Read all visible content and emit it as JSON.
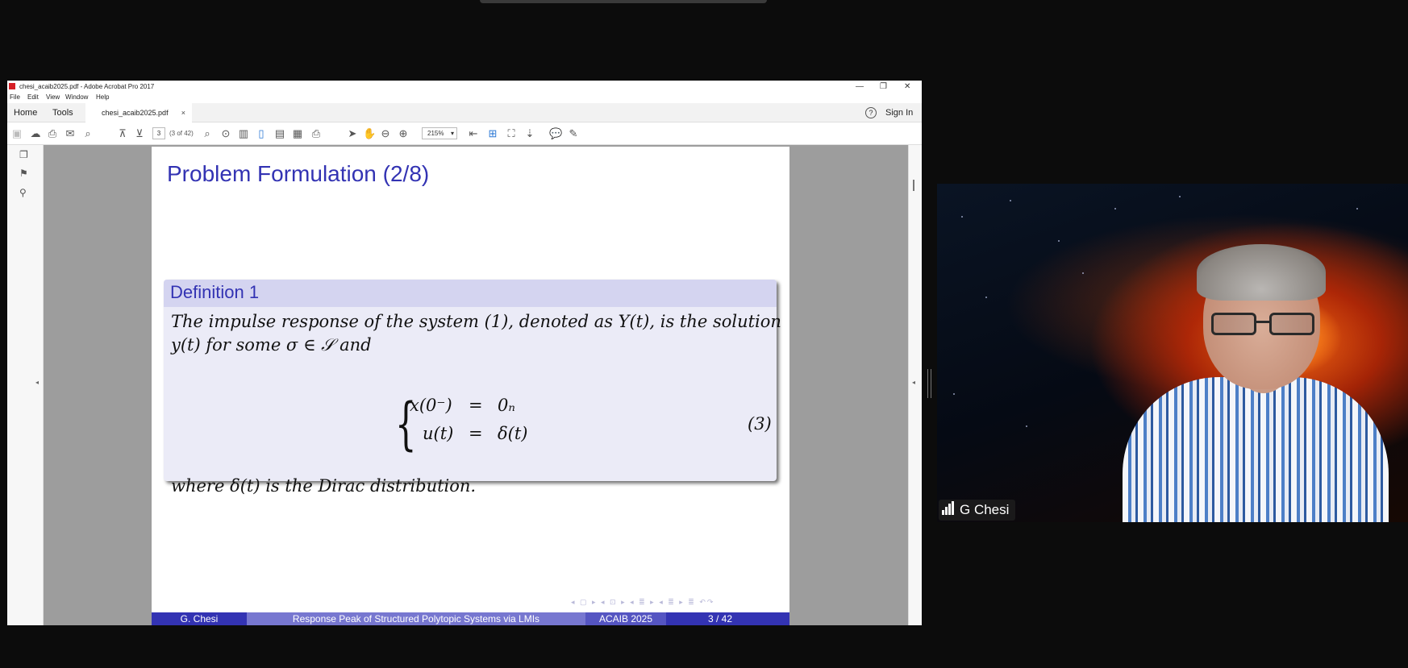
{
  "window": {
    "title": "chesi_acaib2025.pdf - Adobe Acrobat Pro 2017",
    "minimize": "—",
    "restore": "❐",
    "close": "✕"
  },
  "menu": [
    "File",
    "Edit",
    "View",
    "Window",
    "Help"
  ],
  "tabs": {
    "home": "Home",
    "tools": "Tools",
    "document": "chesi_acaib2025.pdf",
    "close": "×",
    "help": "?",
    "signin": "Sign In"
  },
  "toolbar": {
    "page_number": "3",
    "page_of": "(3 of 42)",
    "zoom": "215%"
  },
  "slide": {
    "title": "Problem Formulation (2/8)",
    "definition_title": "Definition 1",
    "line1": "The impulse response of the system (1), denoted as Y(t), is the solution",
    "line2": "y(t) for some σ ∈ 𝒮 and",
    "eq_row1_lhs": "x(0⁻)",
    "eq_row1_rel": "=",
    "eq_row1_rhs": "0ₙ",
    "eq_row2_lhs": "u(t)",
    "eq_row2_rel": "=",
    "eq_row2_rhs": "δ(t)",
    "eq_number": "(3)",
    "where_line": "where δ(t) is the Dirac distribution.",
    "nav_symbols": "◂ ▢ ▸ ◂ ⊡ ▸ ◂ ≣ ▸ ◂ ≣ ▸ ≣ ↶↷",
    "footer": {
      "author": "G. Chesi",
      "talk_title": "Response Peak of Structured Polytopic Systems via LMIs",
      "venue": "ACAIB 2025",
      "page": "3 / 42"
    }
  },
  "video": {
    "participant_name": "G Chesi"
  }
}
